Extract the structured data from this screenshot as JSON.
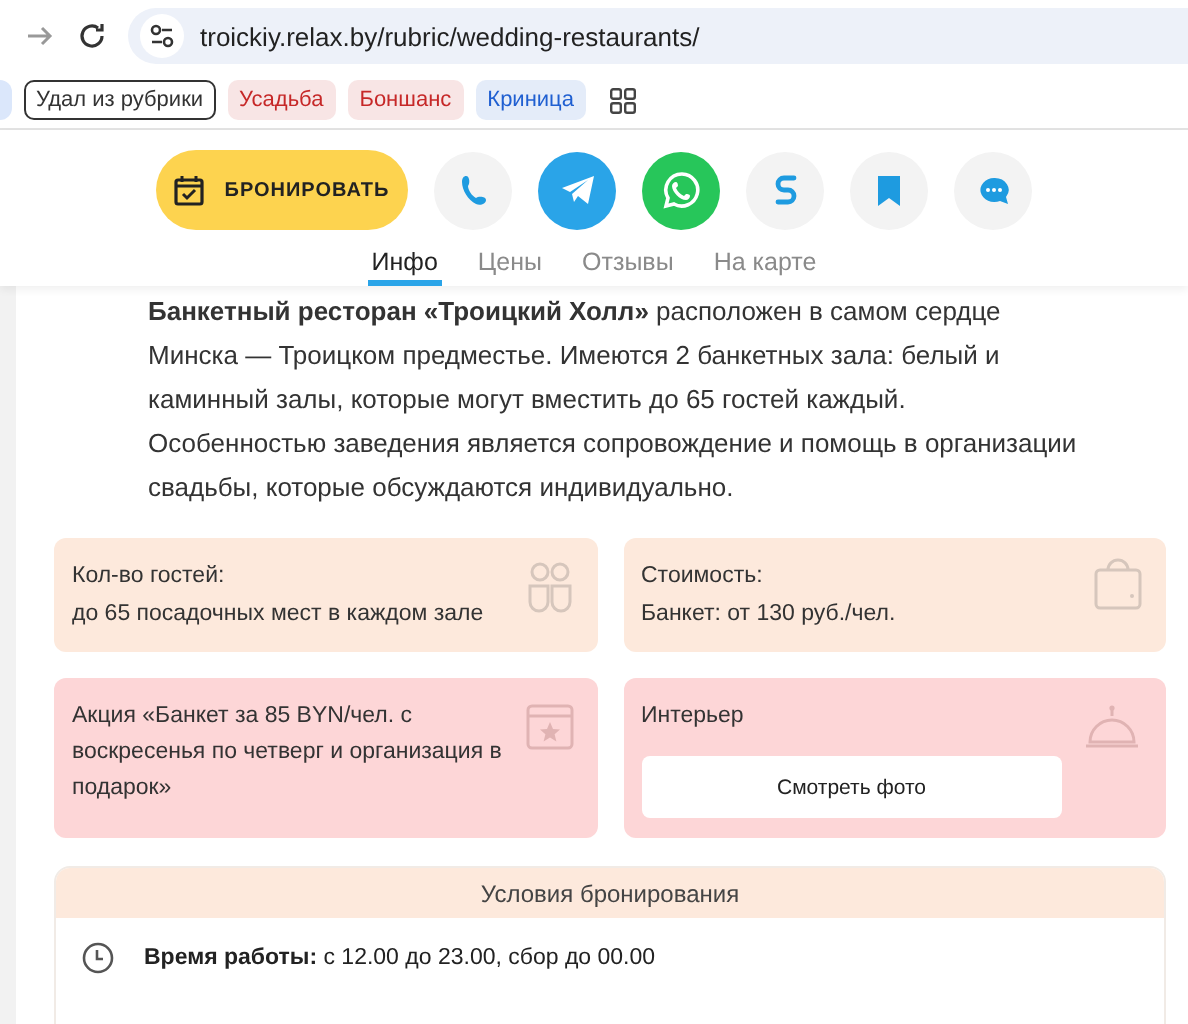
{
  "browser": {
    "url": "troickiy.relax.by/rubric/wedding-restaurants/"
  },
  "bookmarks": [
    {
      "label": "Удал из рубрики",
      "kind": "outlined",
      "color": "#333333"
    },
    {
      "label": "Усадьба",
      "kind": "tag",
      "color": "#c62828"
    },
    {
      "label": "Боншанс",
      "kind": "tag",
      "color": "#c62828"
    },
    {
      "label": "Криница",
      "kind": "tag",
      "color": "#1f5fd1"
    }
  ],
  "actions": {
    "book": "БРОНИРОВАТЬ",
    "buttons": [
      {
        "kind": "phone"
      },
      {
        "kind": "telegram"
      },
      {
        "kind": "whatsapp"
      },
      {
        "kind": "link"
      },
      {
        "kind": "bookmark"
      },
      {
        "kind": "chat"
      }
    ]
  },
  "tabs": [
    {
      "label": "Инфо",
      "selected": true
    },
    {
      "label": "Цены",
      "selected": false
    },
    {
      "label": "Отзывы",
      "selected": false
    },
    {
      "label": "На карте",
      "selected": false
    }
  ],
  "description": "**Банкетный ресторан «Троицкий Холл»** расположен в самом сердце Минска — Троицком предместье. Имеются 2 банкетных зала: белый и каминный залы, которые могут вместить до 65 гостей каждый. Особенностью заведения является сопровождение и помощь в организации свадьбы, которые обсуждаются индивидуально.",
  "cards": [
    {
      "kind": "guests",
      "color": "#fde9dc",
      "lines": [
        "Кол-во гостей:",
        "до 65 посадочных мест в каждом зале"
      ]
    },
    {
      "kind": "price",
      "color": "#fde9dc",
      "lines": [
        "Стоимость:",
        "Банкет: от 130 руб./чел."
      ]
    },
    {
      "kind": "promo",
      "color": "#fdd6d7",
      "lines": [
        "Акция «Банкет за 85 BYN/чел. с воскресенья по четверг и организация в подарок»"
      ]
    },
    {
      "kind": "interior",
      "color": "#fdd6d7",
      "lines": [
        "Интерьер"
      ],
      "button": "Смотреть фото"
    }
  ],
  "conditions": {
    "title": "Условия бронирования",
    "rows": [
      {
        "label": "Время работы:",
        "value": "с 12.00 до 23.00, сбор до 00.00"
      }
    ]
  }
}
